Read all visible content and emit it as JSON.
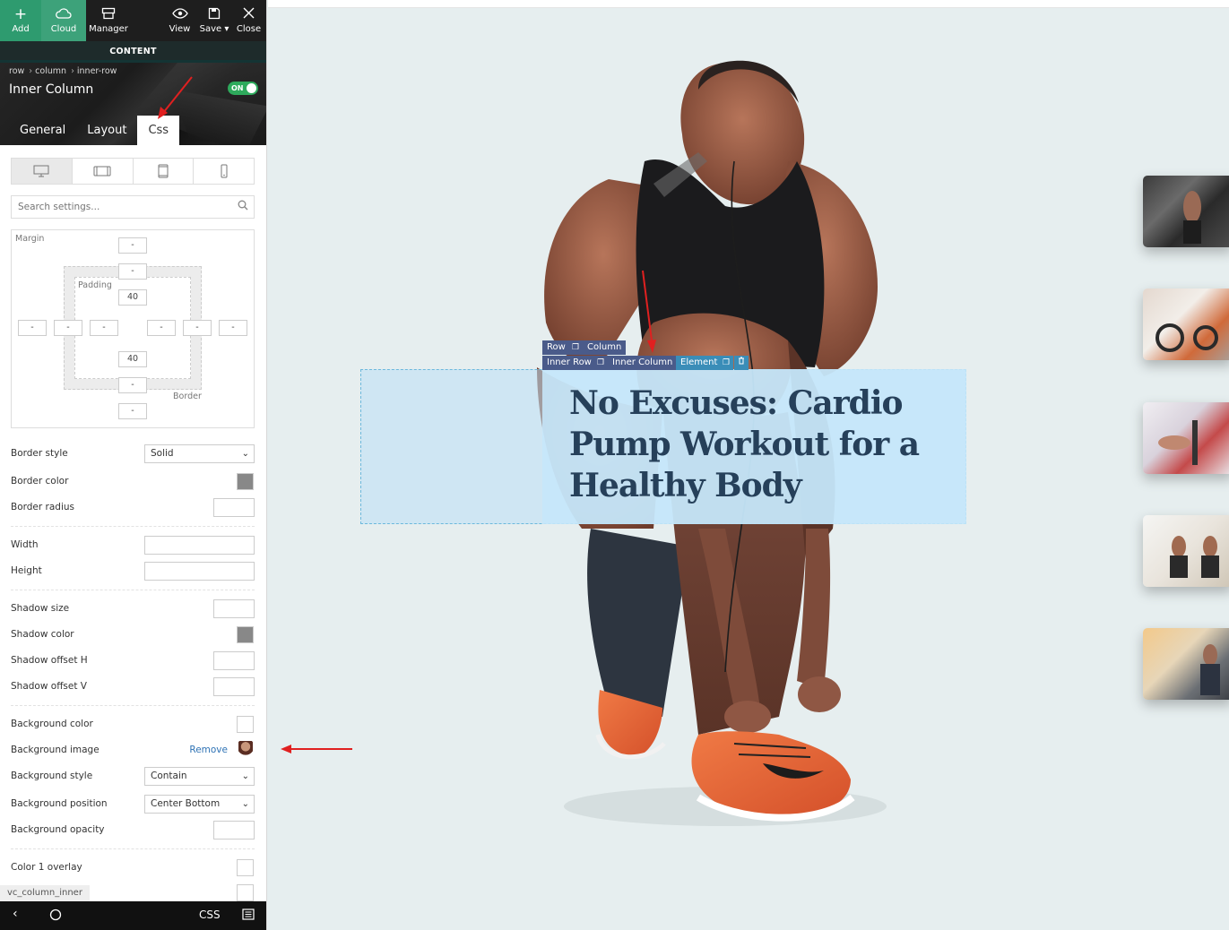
{
  "toolbar": {
    "add": "Add",
    "cloud": "Cloud",
    "manager": "Manager",
    "view": "View",
    "save": "Save",
    "close": "Close"
  },
  "content_bar": "CONTENT",
  "breadcrumb": [
    "row",
    "column",
    "inner-row"
  ],
  "header": {
    "title": "Inner Column",
    "toggle": "ON"
  },
  "tabs": [
    "General",
    "Layout",
    "Css"
  ],
  "active_tab": "Css",
  "search": {
    "placeholder": "Search settings..."
  },
  "box_model": {
    "margin_label": "Margin",
    "padding_label": "Padding",
    "border_label": "Border",
    "margin_top": "-",
    "border_top": "-",
    "padding_top": "40",
    "margin_left": "-",
    "border_left": "-",
    "padding_left": "-",
    "padding_right": "-",
    "border_right": "-",
    "margin_right": "-",
    "padding_bottom": "40",
    "border_bottom": "-",
    "margin_bottom": "-"
  },
  "settings": {
    "border_style_label": "Border style",
    "border_style_value": "Solid",
    "border_color_label": "Border color",
    "border_radius_label": "Border radius",
    "width_label": "Width",
    "height_label": "Height",
    "shadow_size_label": "Shadow size",
    "shadow_color_label": "Shadow color",
    "shadow_offset_h_label": "Shadow offset H",
    "shadow_offset_v_label": "Shadow offset V",
    "background_color_label": "Background color",
    "background_image_label": "Background image",
    "background_image_remove": "Remove",
    "background_style_label": "Background style",
    "background_style_value": "Contain",
    "background_position_label": "Background position",
    "background_position_value": "Center Bottom",
    "background_opacity_label": "Background opacity",
    "color1_overlay_label": "Color 1 overlay"
  },
  "class_tag": "vc_column_inner",
  "bottom_bar": {
    "css": "CSS"
  },
  "canvas": {
    "controls_row1": [
      "Row",
      "Column"
    ],
    "controls_row2": [
      "Inner Row",
      "Inner Column",
      "Element"
    ],
    "hero_title": "No Excuses: Cardio Pump Workout for a Healthy Body"
  },
  "colors": {
    "add_green": "#2e9b6f",
    "toggle_green": "#2eaa5c",
    "ctrl_row": "#4a5b8a",
    "ctrl_inner": "#3a8db8",
    "hero_text": "#26405a",
    "arrow_red": "#e02020"
  }
}
